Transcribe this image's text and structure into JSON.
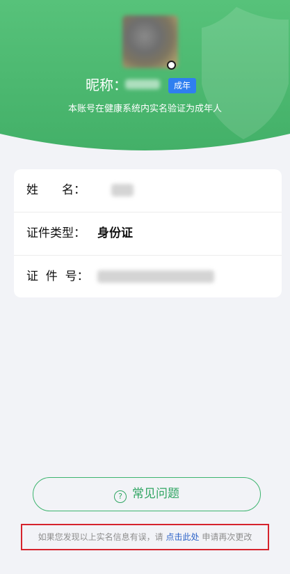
{
  "header": {
    "nickname_label": "昵称：",
    "age_badge": "成年",
    "subtitle": "本账号在健康系统内实名验证为成年人",
    "bg_color": "#4cba72",
    "watermark_icon": "shield-icon"
  },
  "info_card": {
    "rows": [
      {
        "label": "姓　　名："
      },
      {
        "label": "证件类型：",
        "value": "身份证"
      },
      {
        "label": "证  件  号："
      }
    ]
  },
  "faq_button": {
    "icon": "question-circle-icon",
    "label": "常见问题"
  },
  "notice": {
    "prefix": "如果您发现以上实名信息有误，请",
    "link": "点击此处",
    "suffix": "申请再次更改"
  },
  "colors": {
    "accent_green": "#2fa562",
    "badge_blue": "#2f7ff0",
    "link_blue": "#2d63c8",
    "highlight_red": "#d6232c"
  }
}
